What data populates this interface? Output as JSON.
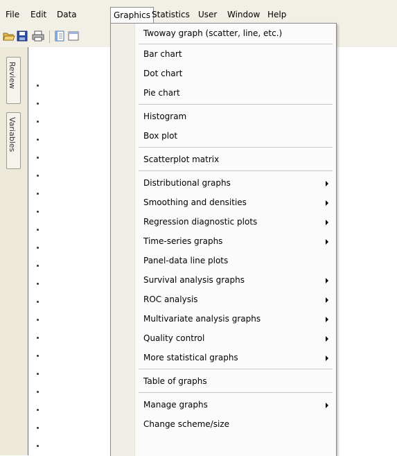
{
  "menubar": {
    "items": [
      {
        "label": "File"
      },
      {
        "label": "Edit"
      },
      {
        "label": "Data"
      },
      {
        "label": "Graphics"
      },
      {
        "label": "Statistics"
      },
      {
        "label": "User"
      },
      {
        "label": "Window"
      },
      {
        "label": "Help"
      }
    ]
  },
  "toolbar": {
    "icons": [
      "open-icon",
      "save-icon",
      "print-icon",
      "log-icon",
      "viewer-icon"
    ]
  },
  "left_tabs": [
    {
      "label": "Review"
    },
    {
      "label": "Variables"
    }
  ],
  "graphics_menu": {
    "items": [
      {
        "label": "Twoway graph (scatter, line, etc.)",
        "submenu": false
      },
      {
        "label": "Bar chart",
        "submenu": false
      },
      {
        "label": "Dot chart",
        "submenu": false
      },
      {
        "label": "Pie chart",
        "submenu": false
      },
      {
        "label": "Histogram",
        "submenu": false
      },
      {
        "label": "Box plot",
        "submenu": false
      },
      {
        "label": "Scatterplot matrix",
        "submenu": false
      },
      {
        "label": "Distributional graphs",
        "submenu": true
      },
      {
        "label": "Smoothing and densities",
        "submenu": true
      },
      {
        "label": "Regression diagnostic plots",
        "submenu": true
      },
      {
        "label": "Time-series graphs",
        "submenu": true
      },
      {
        "label": "Panel-data line plots",
        "submenu": false
      },
      {
        "label": "Survival analysis graphs",
        "submenu": true
      },
      {
        "label": "ROC analysis",
        "submenu": true
      },
      {
        "label": "Multivariate analysis graphs",
        "submenu": true
      },
      {
        "label": "Quality control",
        "submenu": true
      },
      {
        "label": "More statistical graphs",
        "submenu": true
      },
      {
        "label": "Table of graphs",
        "submenu": false
      },
      {
        "label": "Manage graphs",
        "submenu": true
      },
      {
        "label": "Change scheme/size",
        "submenu": false
      }
    ]
  }
}
